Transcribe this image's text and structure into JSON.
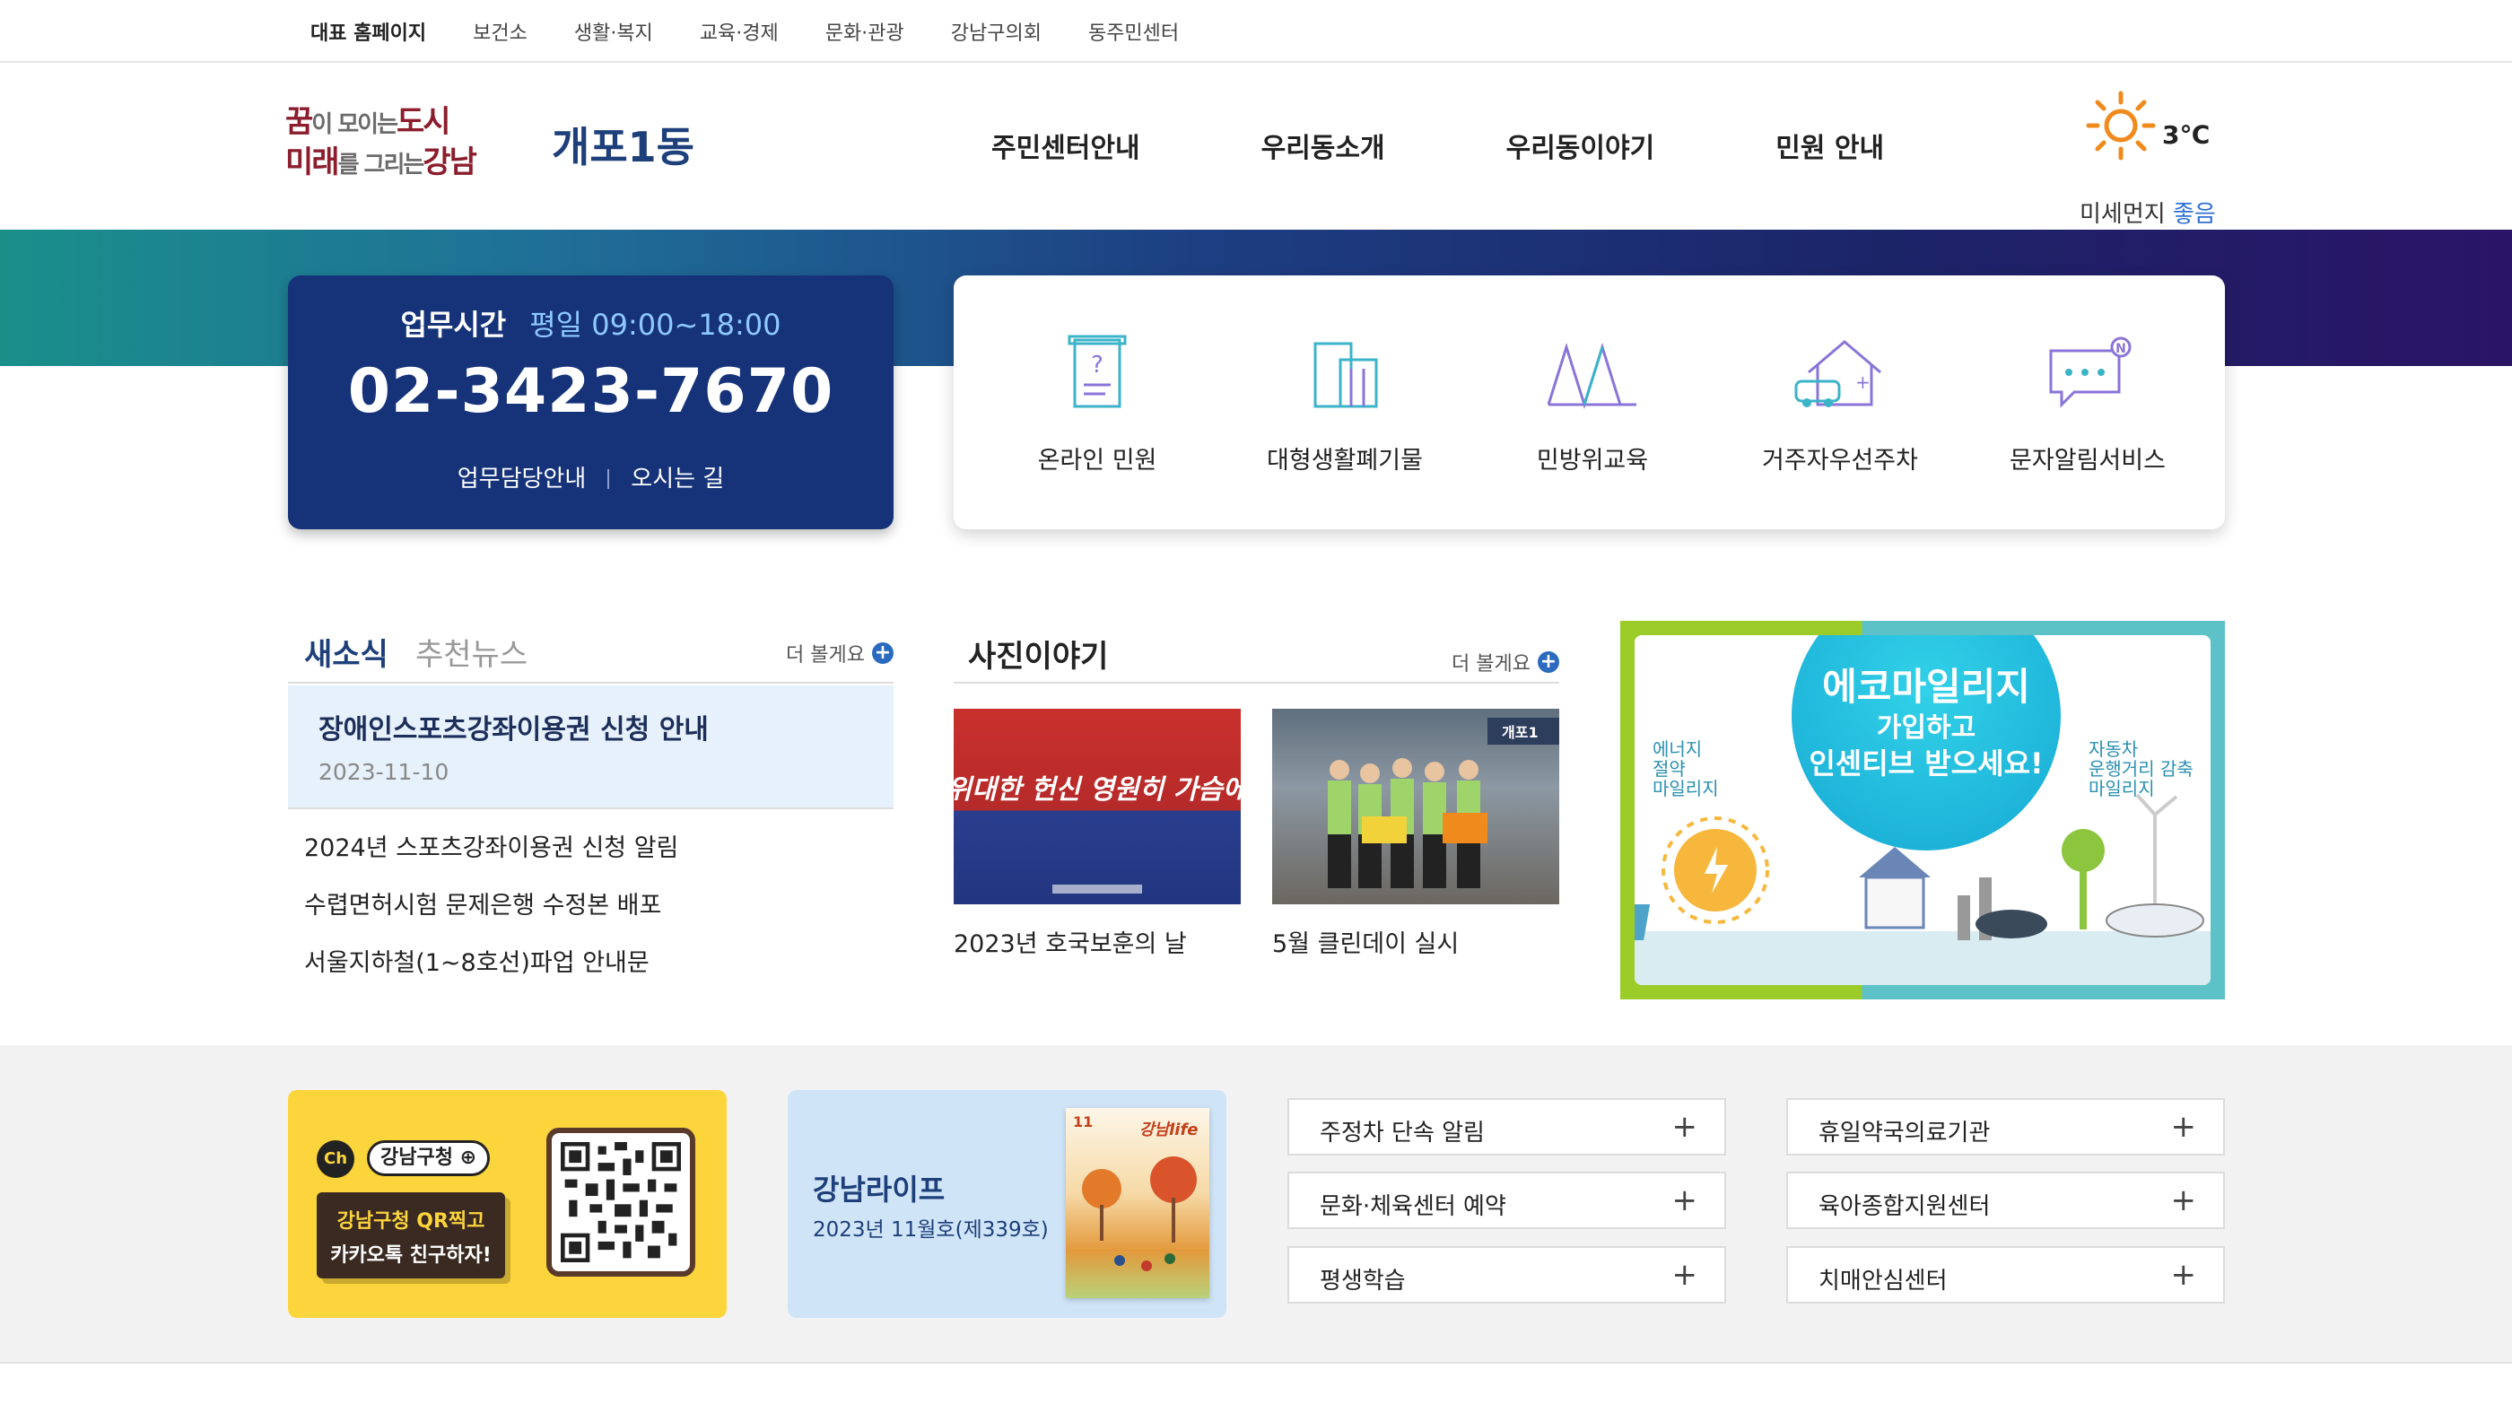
{
  "topbar": {
    "links": [
      "대표 홈페이지",
      "보건소",
      "생활·복지",
      "교육·경제",
      "문화·관광",
      "강남구의회",
      "동주민센터"
    ]
  },
  "header": {
    "logo": {
      "line1_a": "꿈",
      "line1_b": "이 모이는",
      "line1_c": "도시",
      "line2_a": "미래",
      "line2_b": "를 그리는",
      "line2_c": "강남"
    },
    "dong_name": "개포1동",
    "nav": [
      "주민센터안내",
      "우리동소개",
      "우리동이야기",
      "민원 안내"
    ],
    "weather": {
      "temp": "3℃",
      "dust_label": "미세먼지",
      "dust_value": "좋음",
      "icon": "sun-icon"
    }
  },
  "hours": {
    "label": "업무시간",
    "value": "평일 09:00~18:00",
    "phone": "02-3423-7670",
    "link1": "업무담당안내",
    "link2": "오시는 길"
  },
  "quick": [
    {
      "label": "온라인 민원",
      "icon": "online-petition-icon"
    },
    {
      "label": "대형생활폐기물",
      "icon": "bulky-waste-icon"
    },
    {
      "label": "민방위교육",
      "icon": "civil-defense-icon"
    },
    {
      "label": "거주자우선주차",
      "icon": "resident-parking-icon"
    },
    {
      "label": "문자알림서비스",
      "icon": "sms-alert-icon"
    }
  ],
  "news": {
    "tab_active": "새소식",
    "tab_inactive": "추천뉴스",
    "more": "더 볼게요",
    "featured": {
      "title": "장애인스포츠강좌이용권 신청 안내",
      "date": "2023-11-10"
    },
    "items": [
      "2024년 스포츠강좌이용권 신청 알림",
      "수렵면허시험 문제은행 수정본 배포",
      "서울지하철(1~8호선)파업 안내문"
    ]
  },
  "photo": {
    "title": "사진이야기",
    "more": "더 볼게요",
    "items": [
      {
        "caption": "2023년 호국보훈의 날",
        "poster_text": "위대한 헌신 영원히 가슴에"
      },
      {
        "caption": "5월 클린데이 실시",
        "sign_text": "개포1"
      }
    ]
  },
  "eco": {
    "title": "에코마일리지",
    "sub1": "가입하고",
    "sub2": "인센티브 받으세요!",
    "left_text": [
      "에너지",
      "절약",
      "마일리지"
    ],
    "right_text": [
      "자동차",
      "운행거리 감축",
      "마일리지"
    ]
  },
  "kakao": {
    "badge": "Ch",
    "pill": "강남구청 ⊕",
    "line1": "강남구청 QR찍고",
    "line2": "카카오톡 친구하자!"
  },
  "life": {
    "title": "강남라이프",
    "issue": "2023년 11월호(제339호)",
    "cover_num": "11",
    "cover_logo": "강남life"
  },
  "accordions": {
    "left": [
      "주정차 단속 알림",
      "문화·체육센터 예약",
      "평생학습"
    ],
    "right": [
      "휴일약국의료기관",
      "육아종합지원센터",
      "치매안심센터"
    ],
    "plus": "+"
  },
  "colors": {
    "navy": "#16337a",
    "accent_blue": "#2a6bbf",
    "kakao_yellow": "#fcd43b",
    "icon_teal": "#3bb3c9",
    "icon_purple": "#8a74d8"
  }
}
